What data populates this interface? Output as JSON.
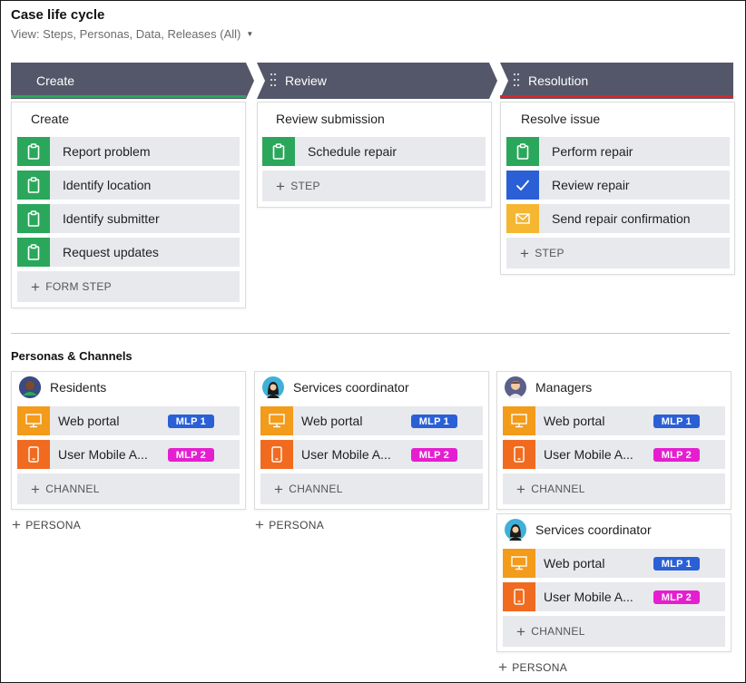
{
  "page": {
    "title": "Case life cycle",
    "view_label": "View: Steps, Personas, Data, Releases (All)"
  },
  "colors": {
    "stage_bg": "#545769",
    "create_bar": "#2aa75b",
    "resolution_bar": "#d6262e",
    "step_green": "#2aa75b",
    "step_blue": "#2a5fd6",
    "step_yellow": "#f5b731",
    "channel_orange_web": "#f39b1a",
    "channel_orange_mobile": "#f06b1f",
    "mlp1": "#2a5fd6",
    "mlp2": "#e51ed0"
  },
  "stages": [
    {
      "name": "Create",
      "process": "Create",
      "steps": [
        {
          "label": "Report problem",
          "icon": "clipboard-icon"
        },
        {
          "label": "Identify location",
          "icon": "clipboard-icon"
        },
        {
          "label": "Identify submitter",
          "icon": "clipboard-icon"
        },
        {
          "label": "Request updates",
          "icon": "clipboard-icon"
        }
      ],
      "add_label": "FORM STEP"
    },
    {
      "name": "Review",
      "process": "Review submission",
      "steps": [
        {
          "label": "Schedule repair",
          "icon": "clipboard-icon"
        }
      ],
      "add_label": "STEP"
    },
    {
      "name": "Resolution",
      "process": "Resolve issue",
      "steps": [
        {
          "label": "Perform repair",
          "icon": "clipboard-icon"
        },
        {
          "label": "Review repair",
          "icon": "checkmark-icon"
        },
        {
          "label": "Send repair confirmation",
          "icon": "envelope-icon"
        }
      ],
      "add_label": "STEP"
    }
  ],
  "personas_section": {
    "title": "Personas & Channels",
    "add_persona_label": "PERSONA",
    "add_channel_label": "CHANNEL",
    "personas": [
      {
        "name": "Residents",
        "channels": [
          {
            "label": "Web portal",
            "badge": "MLP 1"
          },
          {
            "label": "User Mobile A...",
            "badge": "MLP 2"
          }
        ]
      },
      {
        "name": "Services coordinator",
        "channels": [
          {
            "label": "Web portal",
            "badge": "MLP 1"
          },
          {
            "label": "User Mobile A...",
            "badge": "MLP 2"
          }
        ]
      },
      {
        "name": "Managers",
        "channels": [
          {
            "label": "Web portal",
            "badge": "MLP 1"
          },
          {
            "label": "User Mobile A...",
            "badge": "MLP 2"
          }
        ]
      },
      {
        "name": "Services coordinator",
        "channels": [
          {
            "label": "Web portal",
            "badge": "MLP 1"
          },
          {
            "label": "User Mobile A...",
            "badge": "MLP 2"
          }
        ]
      }
    ]
  }
}
